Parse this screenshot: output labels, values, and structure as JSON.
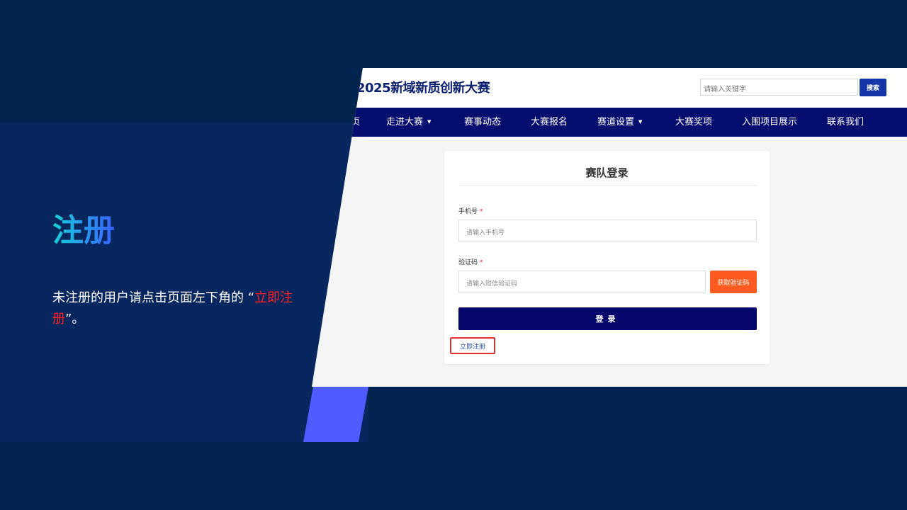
{
  "slide": {
    "heading": "注册",
    "description_prefix": "未注册的用户请点击页面左下角的 “",
    "description_highlight": "立即注册",
    "description_suffix": "”。"
  },
  "site": {
    "title": "2025新域新质创新大赛",
    "search_placeholder": "请输入关键字",
    "search_button": "搜索"
  },
  "nav": {
    "items": [
      {
        "label": "页",
        "has_caret": false
      },
      {
        "label": "走进大赛",
        "has_caret": true
      },
      {
        "label": "赛事动态",
        "has_caret": false
      },
      {
        "label": "大赛报名",
        "has_caret": false
      },
      {
        "label": "赛道设置",
        "has_caret": true
      },
      {
        "label": "大赛奖项",
        "has_caret": false
      },
      {
        "label": "入围项目展示",
        "has_caret": false
      },
      {
        "label": "联系我们",
        "has_caret": false
      }
    ],
    "caret": "▼"
  },
  "login": {
    "title": "赛队登录",
    "phone_label": "手机号",
    "phone_placeholder": "请输入手机号",
    "code_label": "验证码",
    "code_placeholder": "请输入短信验证码",
    "required_mark": "*",
    "get_code_button": "获取验证码",
    "submit_button": "登录",
    "register_link": "立即注册"
  },
  "colors": {
    "slide_bg": "#022350",
    "panel_bg": "#09275f",
    "accent": "#4f5cff",
    "nav_bg": "#050d6e",
    "orange_button": "#ff5a1f",
    "highlight_red": "#ff2222"
  }
}
